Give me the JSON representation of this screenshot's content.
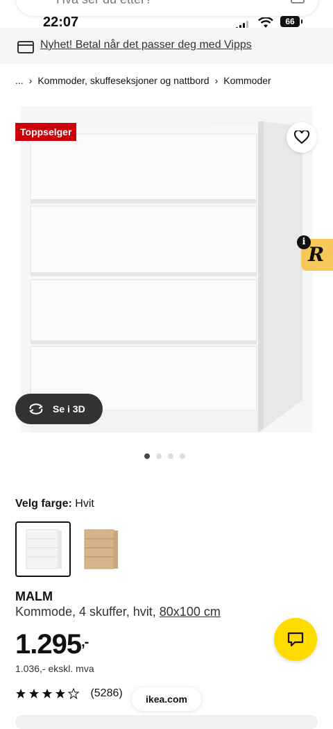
{
  "search": {
    "placeholder": "Hva ser du etter?"
  },
  "status_bar": {
    "time": "22:07",
    "battery": "66"
  },
  "banner": {
    "text": "Nyhet! Betal når det passer deg med Vipps"
  },
  "breadcrumb": {
    "ellipsis": "...",
    "items": [
      "Kommoder, skuffeseksjoner og nattbord",
      "Kommoder"
    ]
  },
  "product": {
    "badge": "Toppselger",
    "view_3d_label": "Se i 3D",
    "gallery": {
      "total": 4,
      "active_index": 0
    },
    "color_label": "Velg farge:",
    "color_value": "Hvit",
    "colors": [
      "Hvit",
      "Hvitbeiset eikefiner"
    ],
    "name": "MALM",
    "description": "Kommode, 4 skuffer, hvit,",
    "dimensions": "80x100 cm",
    "price_main": "1.295",
    "price_suffix": ",-",
    "price_ex_vat": "1.036,- ekskl. mva",
    "rating": 4.5,
    "review_count": "(5286)"
  },
  "url": "ikea.com",
  "colors": {
    "badge": "#cc0008",
    "chat": "#ffdb00",
    "widget": "#f6c759",
    "button_3d": "#333333"
  },
  "icons": [
    "search-icon",
    "camera-icon",
    "card-icon",
    "heart-icon",
    "rotate-3d-icon",
    "chat-icon",
    "star-icon",
    "info-icon"
  ]
}
